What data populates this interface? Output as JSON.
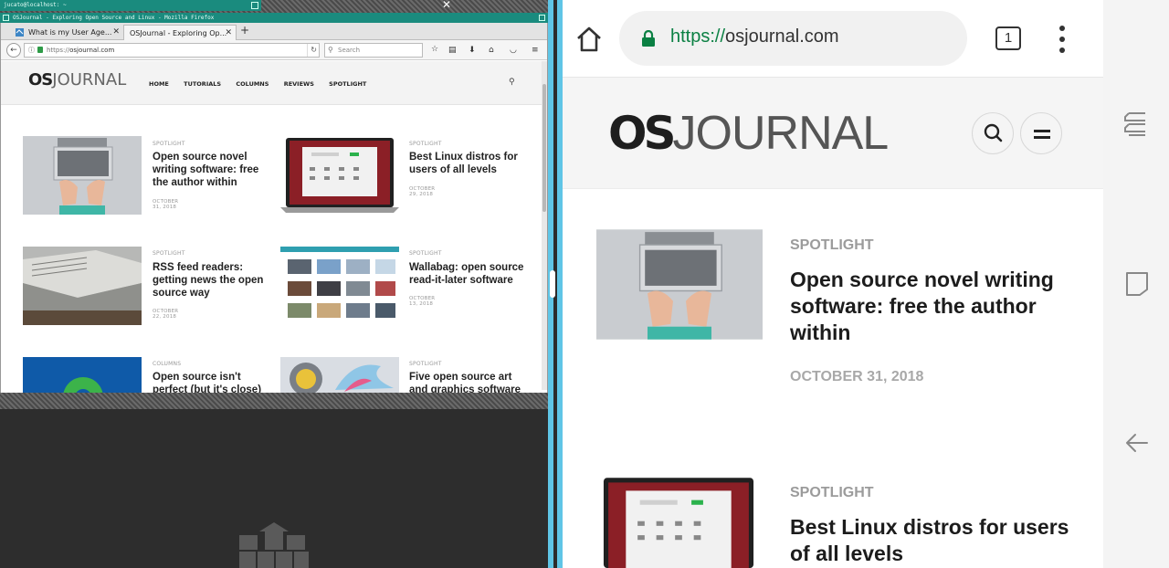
{
  "desktop": {
    "xterm_title": "jucato@localhost: ~",
    "firefox_title": "OSJournal - Exploring Open Source and Linux - Mozilla Firefox",
    "tabs": [
      {
        "label": "What is my User Age..."
      },
      {
        "label": "OSJournal - Exploring Op..."
      }
    ],
    "new_tab_label": "+",
    "url_scheme": "https://",
    "url_host": "osjournal.com",
    "search_placeholder": "Search",
    "site": {
      "logo_os": "OS",
      "logo_journal": "JOURNAL",
      "nav": [
        "HOME",
        "TUTORIALS",
        "COLUMNS",
        "REVIEWS",
        "SPOTLIGHT"
      ],
      "articles": [
        {
          "category": "SPOTLIGHT",
          "title": "Open source novel writing software: free the author within",
          "date": "OCTOBER 31, 2018"
        },
        {
          "category": "SPOTLIGHT",
          "title": "Best Linux distros for users of all levels",
          "date": "OCTOBER 29, 2018"
        },
        {
          "category": "SPOTLIGHT",
          "title": "RSS feed readers: getting news the open source way",
          "date": "OCTOBER 22, 2018"
        },
        {
          "category": "SPOTLIGHT",
          "title": "Wallabag: open source read-it-later software",
          "date": "OCTOBER 13, 2018"
        },
        {
          "category": "COLUMNS",
          "title": "Open source isn't perfect (but it's close)",
          "date": ""
        },
        {
          "category": "SPOTLIGHT",
          "title": "Five open source art and graphics software",
          "date": ""
        }
      ]
    }
  },
  "mobile": {
    "url_scheme": "https://",
    "url_host": "osjournal.com",
    "tab_count": "1",
    "logo_os": "OS",
    "logo_journal": "JOURNAL",
    "articles": [
      {
        "category": "SPOTLIGHT",
        "title": "Open source novel writing software: free the author within",
        "date": "OCTOBER 31, 2018"
      },
      {
        "category": "SPOTLIGHT",
        "title": "Best Linux distros for users of all levels",
        "date": ""
      }
    ]
  },
  "colors": {
    "terminal_teal": "#1a8b7e",
    "split_divider": "#5fc5e6",
    "secure_green": "#0b8043"
  },
  "icons": {
    "toolbar": [
      "home-icon",
      "lock-icon",
      "tab-switcher-icon",
      "overflow-menu-icon"
    ],
    "android_nav": [
      "recents-icon",
      "home-square-icon",
      "back-arrow-icon"
    ]
  }
}
